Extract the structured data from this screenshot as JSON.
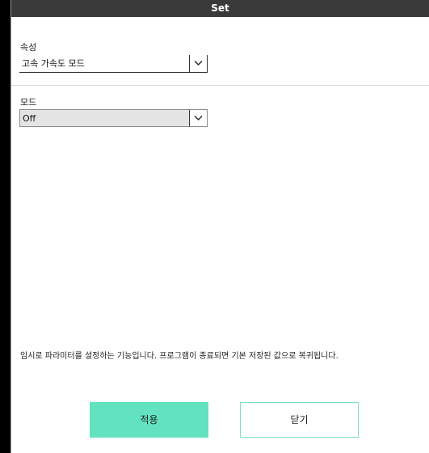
{
  "window": {
    "title": "Set"
  },
  "attribute": {
    "label": "속성",
    "value": "고속 가속도 모드"
  },
  "mode": {
    "label": "모드",
    "value": "Off"
  },
  "notice": "임시로 파라미터를 설정하는 기능입니다. 프로그램이 종료되면 기본 저장된 값으로 복귀됩니다.",
  "buttons": {
    "apply_label": "적용",
    "close_label": "닫기"
  },
  "colors": {
    "titlebar": "#3a3a3a",
    "apply": "#63e2bf",
    "close_border": "#7fdcc4"
  },
  "icons": {
    "dropdown": "chevron-down-icon"
  }
}
